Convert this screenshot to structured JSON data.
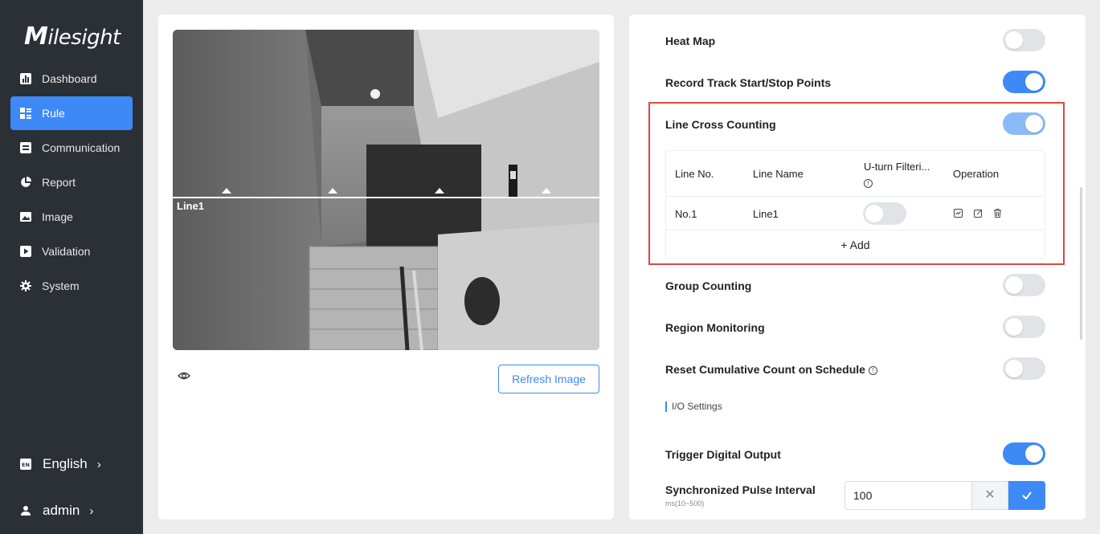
{
  "brand": {
    "logo_text": "Milesight"
  },
  "sidebar": {
    "items": [
      {
        "label": "Dashboard",
        "icon": "bar-chart-icon",
        "active": false
      },
      {
        "label": "Rule",
        "icon": "list-icon",
        "active": true
      },
      {
        "label": "Communication",
        "icon": "message-icon",
        "active": false
      },
      {
        "label": "Report",
        "icon": "pie-chart-icon",
        "active": false
      },
      {
        "label": "Image",
        "icon": "image-icon",
        "active": false
      },
      {
        "label": "Validation",
        "icon": "play-box-icon",
        "active": false
      },
      {
        "label": "System",
        "icon": "gear-icon",
        "active": false
      }
    ],
    "language": {
      "badge": "EN",
      "label": "English",
      "chevron": "›"
    },
    "user": {
      "label": "admin",
      "chevron": "›"
    }
  },
  "preview": {
    "line_label": "Line1",
    "refresh_label": "Refresh Image"
  },
  "settings": {
    "heat_map": {
      "label": "Heat Map",
      "enabled": false
    },
    "record_track": {
      "label": "Record Track Start/Stop Points",
      "enabled": true
    },
    "line_cross": {
      "label": "Line Cross Counting",
      "enabled": true,
      "table": {
        "headers": {
          "line_no": "Line No.",
          "line_name": "Line Name",
          "uturn": "U-turn Filteri...",
          "operation": "Operation"
        },
        "rows": [
          {
            "line_no": "No.1",
            "line_name": "Line1",
            "uturn_enabled": false
          }
        ],
        "add_label": "+ Add"
      }
    },
    "group_counting": {
      "label": "Group Counting",
      "enabled": false
    },
    "region_monitoring": {
      "label": "Region Monitoring",
      "enabled": false
    },
    "reset_cumulative": {
      "label": "Reset Cumulative Count on Schedule",
      "enabled": false
    },
    "io_section": "I/O Settings",
    "trigger_output": {
      "label": "Trigger Digital Output",
      "enabled": true
    },
    "pulse_interval": {
      "label": "Synchronized Pulse Interval",
      "hint": "ms(10~500)",
      "value": "100"
    }
  },
  "colors": {
    "accent": "#3d8af7",
    "sidebar_bg": "#2b2f36",
    "highlight_border": "#e0483e"
  }
}
